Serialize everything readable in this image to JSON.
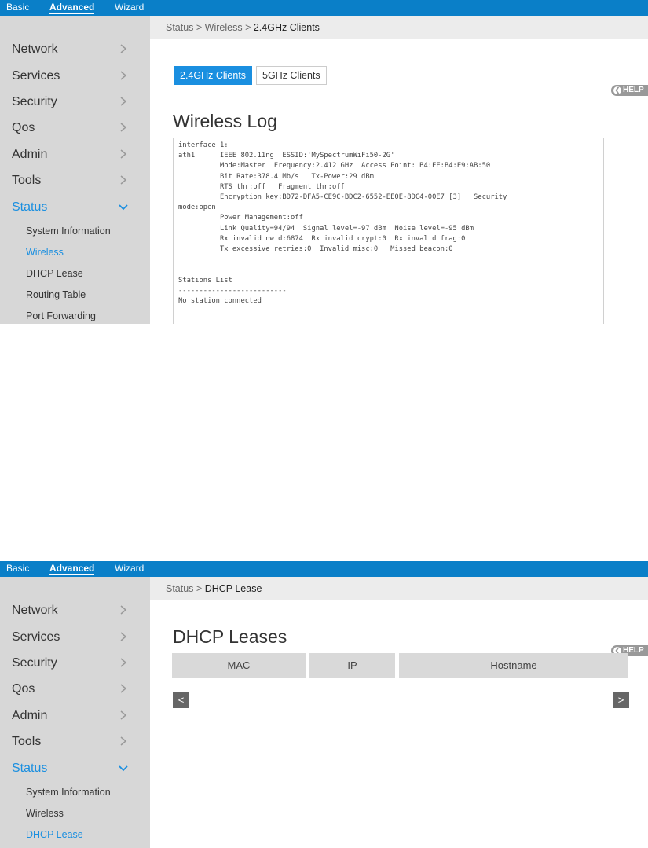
{
  "screenshot1": {
    "topbar": {
      "tabs": [
        "Basic",
        "Advanced",
        "Wizard"
      ],
      "active_tab": "Advanced"
    },
    "sidebar": {
      "items": [
        "Network",
        "Services",
        "Security",
        "Qos",
        "Admin",
        "Tools",
        "Status"
      ],
      "expanded": "Status",
      "subitems": [
        "System Information",
        "Wireless",
        "DHCP Lease",
        "Routing Table",
        "Port Forwarding"
      ],
      "active_subitem": "Wireless"
    },
    "breadcrumb": {
      "path": "Status > Wireless > ",
      "current": "2.4GHz Clients"
    },
    "tabs": [
      "2.4GHz Clients",
      "5GHz Clients"
    ],
    "active_tab": "2.4GHz Clients",
    "help_label": "HELP",
    "title": "Wireless Log",
    "log_lines": [
      "interface 1:",
      "ath1      IEEE 802.11ng  ESSID:'MySpectrumWiFi50-2G'",
      "          Mode:Master  Frequency:2.412 GHz  Access Point: B4:EE:B4:E9:AB:50",
      "          Bit Rate:378.4 Mb/s   Tx-Power:29 dBm",
      "          RTS thr:off   Fragment thr:off",
      "          Encryption key:BD72-DFA5-CE9C-BDC2-6552-EE0E-8DC4-00E7 [3]   Security",
      "mode:open",
      "          Power Management:off",
      "          Link Quality=94/94  Signal level=-97 dBm  Noise level=-95 dBm",
      "          Rx invalid nwid:6874  Rx invalid crypt:0  Rx invalid frag:0",
      "          Tx excessive retries:0  Invalid misc:0   Missed beacon:0",
      "",
      "",
      "Stations List",
      "--------------------------",
      "No station connected"
    ]
  },
  "screenshot2": {
    "topbar": {
      "tabs": [
        "Basic",
        "Advanced",
        "Wizard"
      ],
      "active_tab": "Advanced"
    },
    "sidebar": {
      "items": [
        "Network",
        "Services",
        "Security",
        "Qos",
        "Admin",
        "Tools",
        "Status"
      ],
      "expanded": "Status",
      "subitems": [
        "System Information",
        "Wireless",
        "DHCP Lease"
      ],
      "active_subitem": "DHCP Lease"
    },
    "breadcrumb": {
      "path": "Status > ",
      "current": "DHCP Lease"
    },
    "help_label": "HELP",
    "title": "DHCP Leases",
    "table": {
      "columns": [
        "MAC",
        "IP",
        "Hostname"
      ],
      "rows": []
    },
    "pager": {
      "prev": "<",
      "next": ">"
    }
  },
  "colors": {
    "topbar": "#0a7fc8",
    "accent": "#1a8fe0",
    "sidebar": "#d7d7d7",
    "header_cell": "#d9d9d9"
  }
}
